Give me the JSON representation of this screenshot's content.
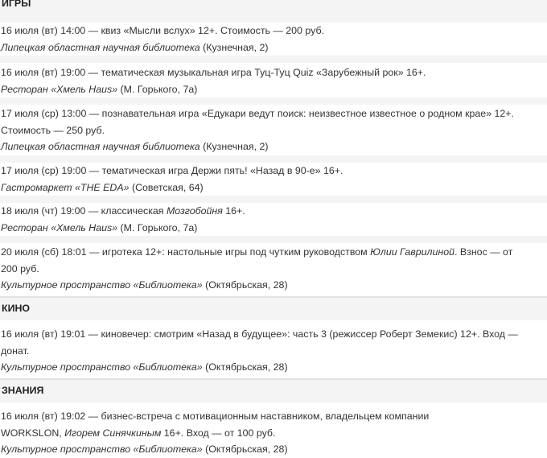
{
  "sections": [
    {
      "title": "ИГРЫ",
      "events": [
        {
          "lines": [
            {
              "text": "16 июля (вт) 14:00 — квиз «Мысли вслух» 12+. Стоимость — 200 руб."
            }
          ],
          "place": "Липецкая областная научная библиотека",
          "address": " (Кузнечная, 2)"
        },
        {
          "lines": [
            {
              "text": "16 июля (вт) 19:00 — тематическая музыкальная игра Туц-Туц Quiz «Зарубежный рок» 16+."
            }
          ],
          "place": "Ресторан «Хмель Haus»",
          "address": " (М. Горького, 7а)"
        },
        {
          "lines": [
            {
              "text": "17 июля (ср) 13:00 — познавательная игра «Едукари ведут поиск: неизвестное известное о родном крае» 12+."
            },
            {
              "text": "Стоимость — 250 руб."
            }
          ],
          "place": "Липецкая областная научная библиотека",
          "address": " (Кузнечная, 2)"
        },
        {
          "lines": [
            {
              "text": "17 июля (ср) 19:00 — тематическая игра Держи пять! «Назад в 90-е» 16+."
            }
          ],
          "place": "Гастромаркет «THE EDA»",
          "address": " (Советская, 64)"
        },
        {
          "lines": [
            {
              "pre": "18 июля (чт) 19:00 — классическая ",
              "em": "Мозгобойня",
              "post": " 16+."
            }
          ],
          "place": "Ресторан «Хмель Haus»",
          "address": " (М. Горького, 7а)"
        },
        {
          "lines": [
            {
              "pre": "20 июля (сб) 18:01 — игротека 12+: настольные игры под чутким руководством ",
              "em": "Юлии Гаврилиной",
              "post": ". Взнос — от"
            },
            {
              "text": "200 руб."
            }
          ],
          "place": "Культурное пространство «Библиотека»",
          "address": " (Октябрьская, 28)"
        }
      ]
    },
    {
      "title": "КИНО",
      "events": [
        {
          "lines": [
            {
              "text": "16 июля (вт) 19:01 — киновечер: смотрим «Назад в будущее»: часть 3 (режиссер Роберт Земекис) 12+. Вход —"
            },
            {
              "text": "донат."
            }
          ],
          "place": "Культурное пространство «Библиотека»",
          "address": " (Октябрьская, 28)"
        }
      ]
    },
    {
      "title": "ЗНАНИЯ",
      "events": [
        {
          "lines": [
            {
              "text": "16 июля (вт) 19:02 — бизнес-встреча с мотивационным наставником, владельцем компании"
            },
            {
              "pre": "WORKSLON, ",
              "em": "Игорем Синячкиным",
              "post": " 16+. Вход — от 100 руб."
            }
          ],
          "place": "Культурное пространство «Библиотека»",
          "address": " (Октябрьская, 28)"
        }
      ]
    }
  ]
}
